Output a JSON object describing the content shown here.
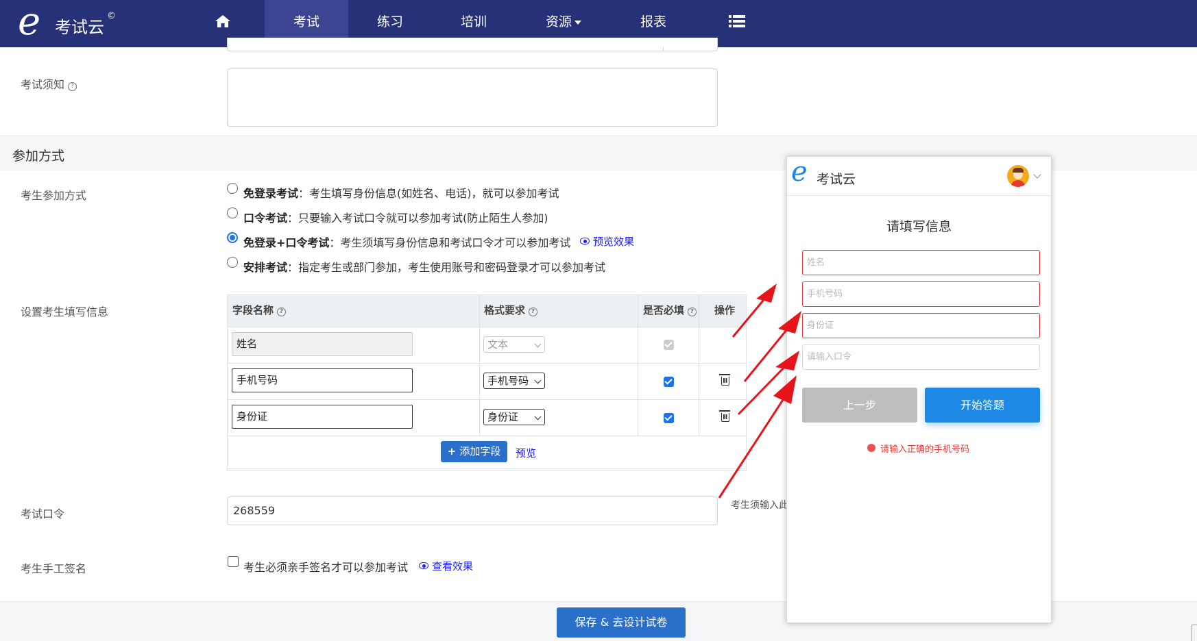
{
  "nav": {
    "logo_letter": "e",
    "logo_text": "考试云",
    "logo_mark": "©",
    "home_icon": "home-icon",
    "items": [
      {
        "label": "考试",
        "active": true
      },
      {
        "label": "练习",
        "active": false
      },
      {
        "label": "培训",
        "active": false
      },
      {
        "label": "资源",
        "active": false,
        "dropdown": true
      },
      {
        "label": "报表",
        "active": false
      }
    ],
    "menu_icon": "list-icon",
    "colors": {
      "bar": "#273178",
      "active": "#3a4490"
    }
  },
  "form": {
    "notice_label": "考试须知",
    "section_title": "参加方式",
    "join_label": "考生参加方式",
    "join_options": [
      {
        "name": "免登录考试",
        "desc": "：考生填写身份信息(如姓名、电话)，就可以参加考试",
        "selected": false
      },
      {
        "name": "口令考试",
        "desc": "：只要输入考试口令就可以参加考试(防止陌生人参加)",
        "selected": false
      },
      {
        "name": "免登录+口令考试",
        "desc": "：考生须填写身份信息和考试口令才可以参加考试",
        "selected": true,
        "link": "预览效果"
      },
      {
        "name": "安排考试",
        "desc": "：指定考生或部门参加，考生使用账号和密码登录才可以参加考试",
        "selected": false
      }
    ],
    "fields_label": "设置考生填写信息",
    "table": {
      "headers": {
        "name": "字段名称",
        "format": "格式要求",
        "required": "是否必填",
        "action": "操作"
      },
      "rows": [
        {
          "name": "姓名",
          "format": "文本",
          "required": true,
          "locked": true
        },
        {
          "name": "手机号码",
          "format": "手机号码",
          "required": true,
          "locked": false
        },
        {
          "name": "身份证",
          "format": "身份证",
          "required": true,
          "locked": false
        }
      ],
      "add_button": "添加字段",
      "preview_link": "预览"
    },
    "password_label": "考试口令",
    "password_value": "268559",
    "password_hint": "考生须输入此",
    "sign_label": "考生手工签名",
    "sign_option": "考生必须亲手签名才可以参加考试",
    "sign_link": "查看效果",
    "save_button": "保存 & 去设计试卷"
  },
  "phone": {
    "logo_letter": "e",
    "logo_text": "考试云",
    "avatar_icon": "user-avatar-icon",
    "title": "请填写信息",
    "inputs": [
      {
        "placeholder": "姓名",
        "error": true
      },
      {
        "placeholder": "手机号码",
        "error": true
      },
      {
        "placeholder": "身份证",
        "error": true
      },
      {
        "placeholder": "请输入口令",
        "error": false
      }
    ],
    "prev_button": "上一步",
    "start_button": "开始答题",
    "error_message": "请输入正确的手机号码",
    "colors": {
      "error": "#e53935",
      "start": "#1e88e5",
      "prev": "#bdbdbd"
    }
  },
  "annotation": {
    "arrow_color": "#e8141b"
  }
}
